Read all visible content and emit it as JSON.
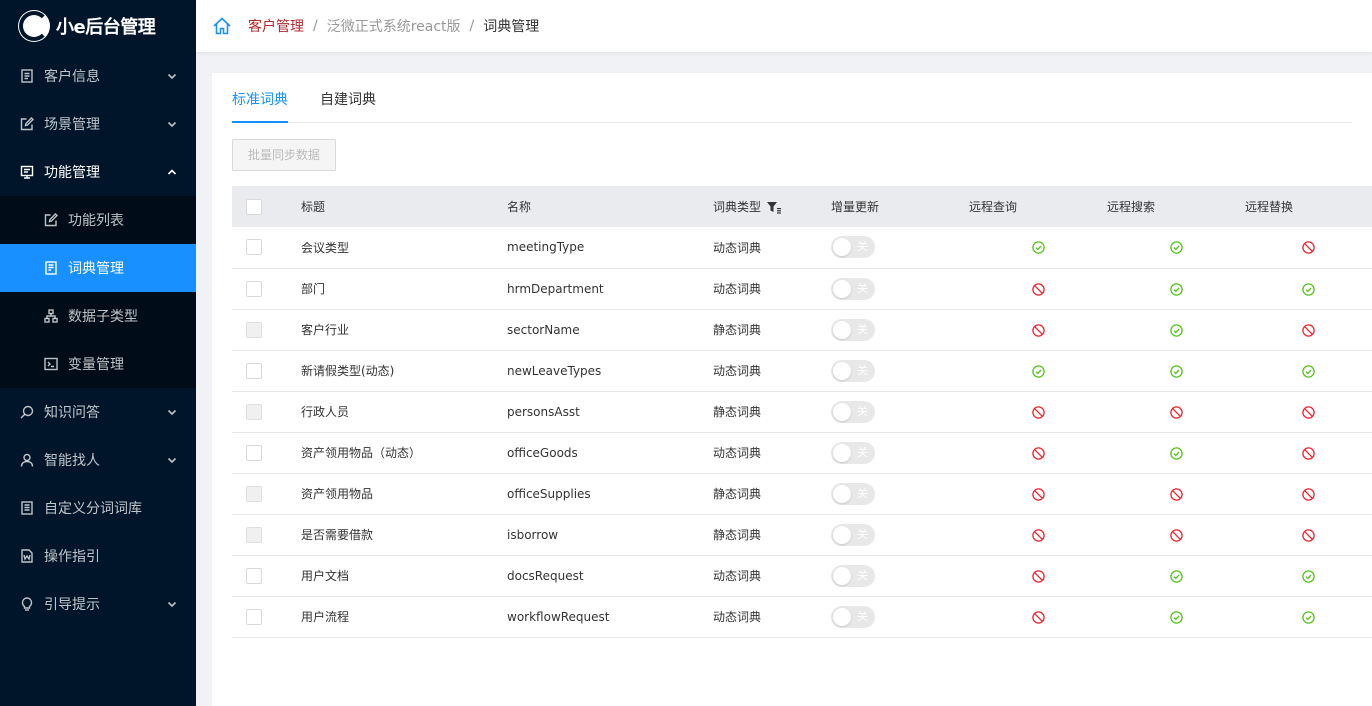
{
  "app": {
    "logo_text": "小e后台管理"
  },
  "sidebar": {
    "items": [
      {
        "label": "客户信息",
        "icon": "document-icon",
        "arrow": "down"
      },
      {
        "label": "场景管理",
        "icon": "edit-icon",
        "arrow": "down"
      },
      {
        "label": "功能管理",
        "icon": "function-icon",
        "arrow": "up"
      },
      {
        "label": "知识问答",
        "icon": "search-icon",
        "arrow": "down"
      },
      {
        "label": "智能找人",
        "icon": "user-icon",
        "arrow": "down"
      },
      {
        "label": "自定义分词词库",
        "icon": "list-icon"
      },
      {
        "label": "操作指引",
        "icon": "word-icon"
      },
      {
        "label": "引导提示",
        "icon": "bulb-icon",
        "arrow": "down"
      }
    ],
    "submenu": [
      {
        "label": "功能列表",
        "icon": "edit-icon"
      },
      {
        "label": "词典管理",
        "icon": "dictionary-icon"
      },
      {
        "label": "数据子类型",
        "icon": "hierarchy-icon"
      },
      {
        "label": "变量管理",
        "icon": "code-icon"
      }
    ]
  },
  "breadcrumb": [
    "客户管理",
    "泛微正式系统react版",
    "词典管理"
  ],
  "tabs": [
    "标准词典",
    "自建词典"
  ],
  "batch_button": "批量同步数据",
  "table": {
    "headers": [
      "标题",
      "名称",
      "词典类型",
      "增量更新",
      "远程查询",
      "远程搜索",
      "远程替换"
    ],
    "switch_label": "关",
    "rows": [
      {
        "title": "会议类型",
        "name": "meetingType",
        "type": "动态词典",
        "query": "ok",
        "search": "ok",
        "replace": "no",
        "cb_disabled": false
      },
      {
        "title": "部门",
        "name": "hrmDepartment",
        "type": "动态词典",
        "query": "no",
        "search": "ok",
        "replace": "ok",
        "cb_disabled": false
      },
      {
        "title": "客户行业",
        "name": "sectorName",
        "type": "静态词典",
        "query": "no",
        "search": "ok",
        "replace": "no",
        "cb_disabled": true
      },
      {
        "title": "新请假类型(动态)",
        "name": "newLeaveTypes",
        "type": "动态词典",
        "query": "ok",
        "search": "ok",
        "replace": "ok",
        "cb_disabled": false
      },
      {
        "title": "行政人员",
        "name": "personsAsst",
        "type": "静态词典",
        "query": "no",
        "search": "no",
        "replace": "no",
        "cb_disabled": true
      },
      {
        "title": "资产领用物品（动态）",
        "name": "officeGoods",
        "type": "动态词典",
        "query": "no",
        "search": "ok",
        "replace": "no",
        "cb_disabled": false
      },
      {
        "title": "资产领用物品",
        "name": "officeSupplies",
        "type": "静态词典",
        "query": "no",
        "search": "no",
        "replace": "no",
        "cb_disabled": true
      },
      {
        "title": "是否需要借款",
        "name": "isborrow",
        "type": "静态词典",
        "query": "no",
        "search": "no",
        "replace": "no",
        "cb_disabled": true
      },
      {
        "title": "用户文档",
        "name": "docsRequest",
        "type": "动态词典",
        "query": "no",
        "search": "ok",
        "replace": "ok",
        "cb_disabled": false
      },
      {
        "title": "用户流程",
        "name": "workflowRequest",
        "type": "动态词典",
        "query": "no",
        "search": "ok",
        "replace": "ok",
        "cb_disabled": false
      }
    ]
  },
  "colors": {
    "sidebar_bg": "#001529",
    "accent": "#1890ff",
    "ok": "#52c41a",
    "no": "#f5222d"
  }
}
